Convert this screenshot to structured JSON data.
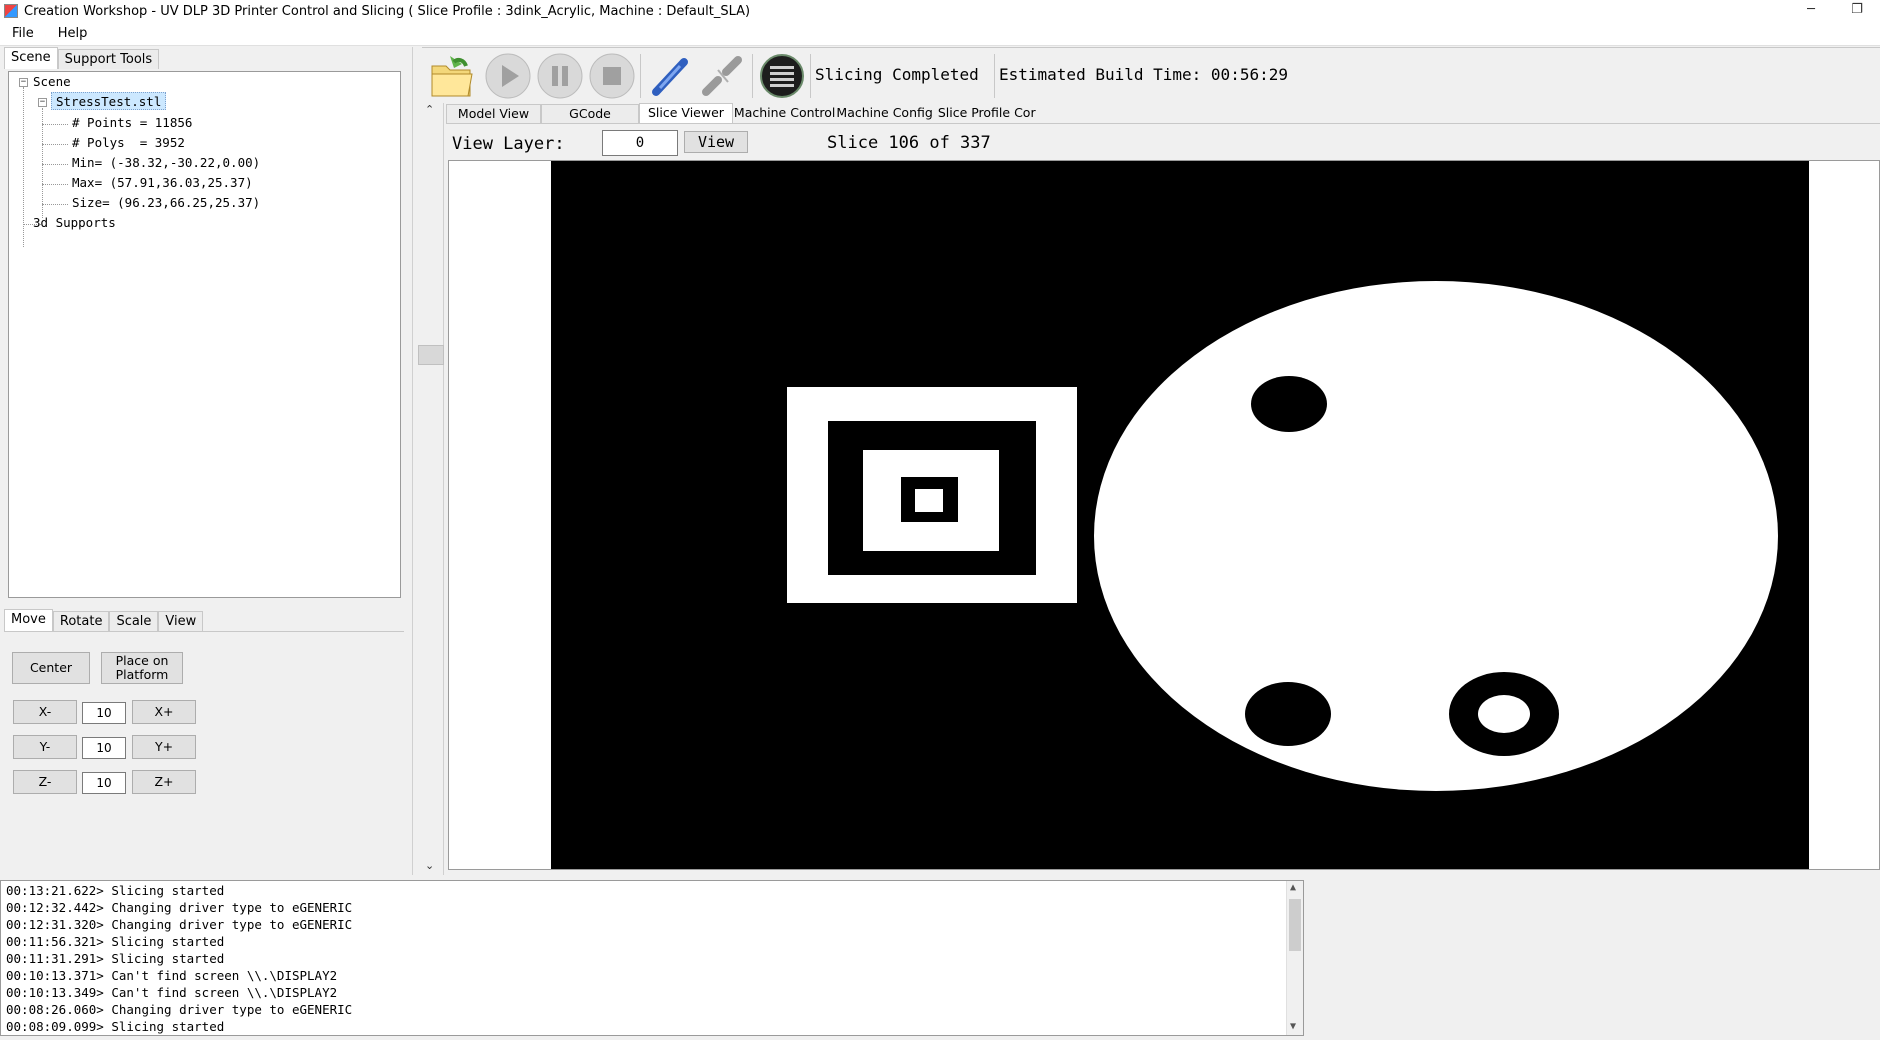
{
  "window": {
    "title": "Creation Workshop - UV DLP 3D Printer Control and Slicing  ( Slice Profile : 3dink_Acrylic, Machine : Default_SLA)",
    "minimize": "─",
    "restore": "❐"
  },
  "menu": {
    "file": "File",
    "help": "Help"
  },
  "left_tabs": {
    "scene": "Scene",
    "support": "Support Tools"
  },
  "tree": {
    "root": "Scene",
    "model": "StressTest.stl",
    "points": "# Points = 11856",
    "polys": "# Polys  = 3952",
    "min": "Min= (-38.32,-30.22,0.00)",
    "max": "Max= (57.91,36.03,25.37)",
    "size": "Size= (96.23,66.25,25.37)",
    "supports": "3d Supports"
  },
  "transform_tabs": {
    "move": "Move",
    "rotate": "Rotate",
    "scale": "Scale",
    "view": "View"
  },
  "move": {
    "center": "Center",
    "place_line1": "Place on",
    "place_line2": "Platform",
    "x_minus": "X-",
    "x_plus": "X+",
    "x_value": "10",
    "y_minus": "Y-",
    "y_plus": "Y+",
    "y_value": "10",
    "z_minus": "Z-",
    "z_plus": "Z+",
    "z_value": "10"
  },
  "toolbar": {
    "status": "Slicing Completed",
    "build_time": "Estimated Build Time: 00:56:29"
  },
  "main_tabs": {
    "model_view": "Model View",
    "gcode": "GCode",
    "slice_viewer": "Slice Viewer",
    "machine_control": "Machine Control",
    "machine_config": "Machine Config",
    "slice_profile": "Slice Profile Cor"
  },
  "slice_viewer": {
    "view_layer_label": "View Layer:",
    "layer_value": "0",
    "view_button": "View",
    "slice_status": "Slice 106 of 337"
  },
  "log": [
    "00:13:21.622> Slicing started",
    "00:12:32.442> Changing driver type to eGENERIC",
    "00:12:31.320> Changing driver type to eGENERIC",
    "00:11:56.321> Slicing started",
    "00:11:31.291> Slicing started",
    "00:10:13.371> Can't find screen \\\\.\\DISPLAY2",
    "00:10:13.349> Can't find screen \\\\.\\DISPLAY2",
    "00:08:26.060> Changing driver type to eGENERIC",
    "00:08:09.099> Slicing started"
  ]
}
